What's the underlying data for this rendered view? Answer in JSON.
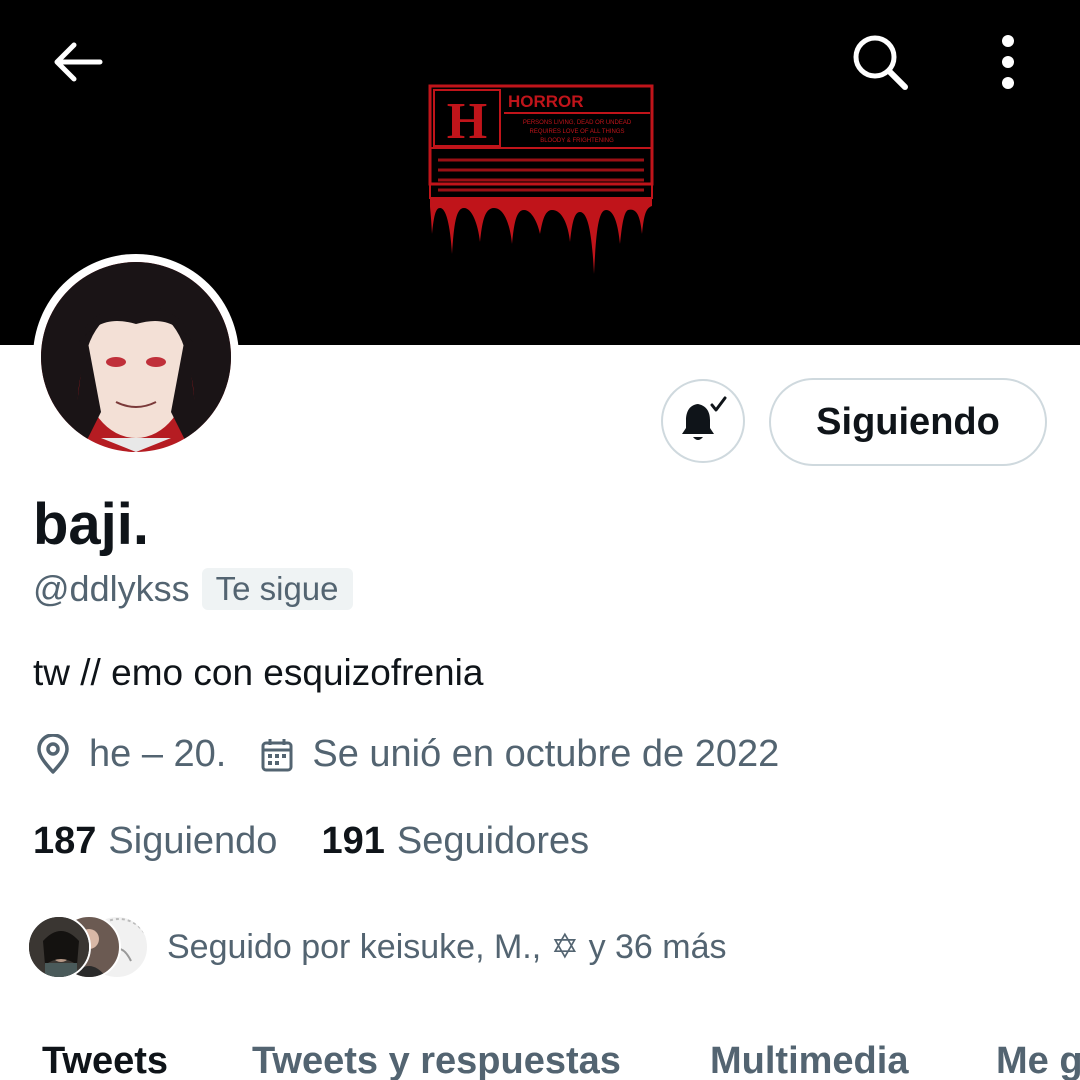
{
  "header": {
    "back_icon": "arrow-left-icon",
    "search_icon": "search-icon",
    "more_icon": "more-vertical-icon"
  },
  "banner": {
    "poster_letter": "H",
    "poster_title": "HORROR",
    "poster_text_1": "PERSONS LIVING, DEAD OR UNDEAD",
    "poster_text_2": "REQUIRES LOVE OF ALL THINGS",
    "poster_text_3": "BLOODY & FRIGHTENING",
    "accent": "#c0141a"
  },
  "actions": {
    "notify_icon": "bell-check-icon",
    "follow_label": "Siguiendo"
  },
  "profile": {
    "name": "baji.",
    "handle": "@ddlykss",
    "follows_you": "Te sigue",
    "bio": "tw // emo con esquizofrenia",
    "location": "he – 20.",
    "joined": "Se unió en octubre de 2022"
  },
  "stats": {
    "following_count": "187",
    "following_label": "Siguiendo",
    "followers_count": "191",
    "followers_label": "Seguidores"
  },
  "followed_by": {
    "text": "Seguido por keisuke, M., ✡ y 36 más"
  },
  "tabs": [
    {
      "label": "Tweets"
    },
    {
      "label": "Tweets y respuestas"
    },
    {
      "label": "Multimedia"
    },
    {
      "label": "Me g"
    }
  ],
  "colors": {
    "text_primary": "#0f1419",
    "text_secondary": "#536471",
    "border": "#cfd9de"
  }
}
